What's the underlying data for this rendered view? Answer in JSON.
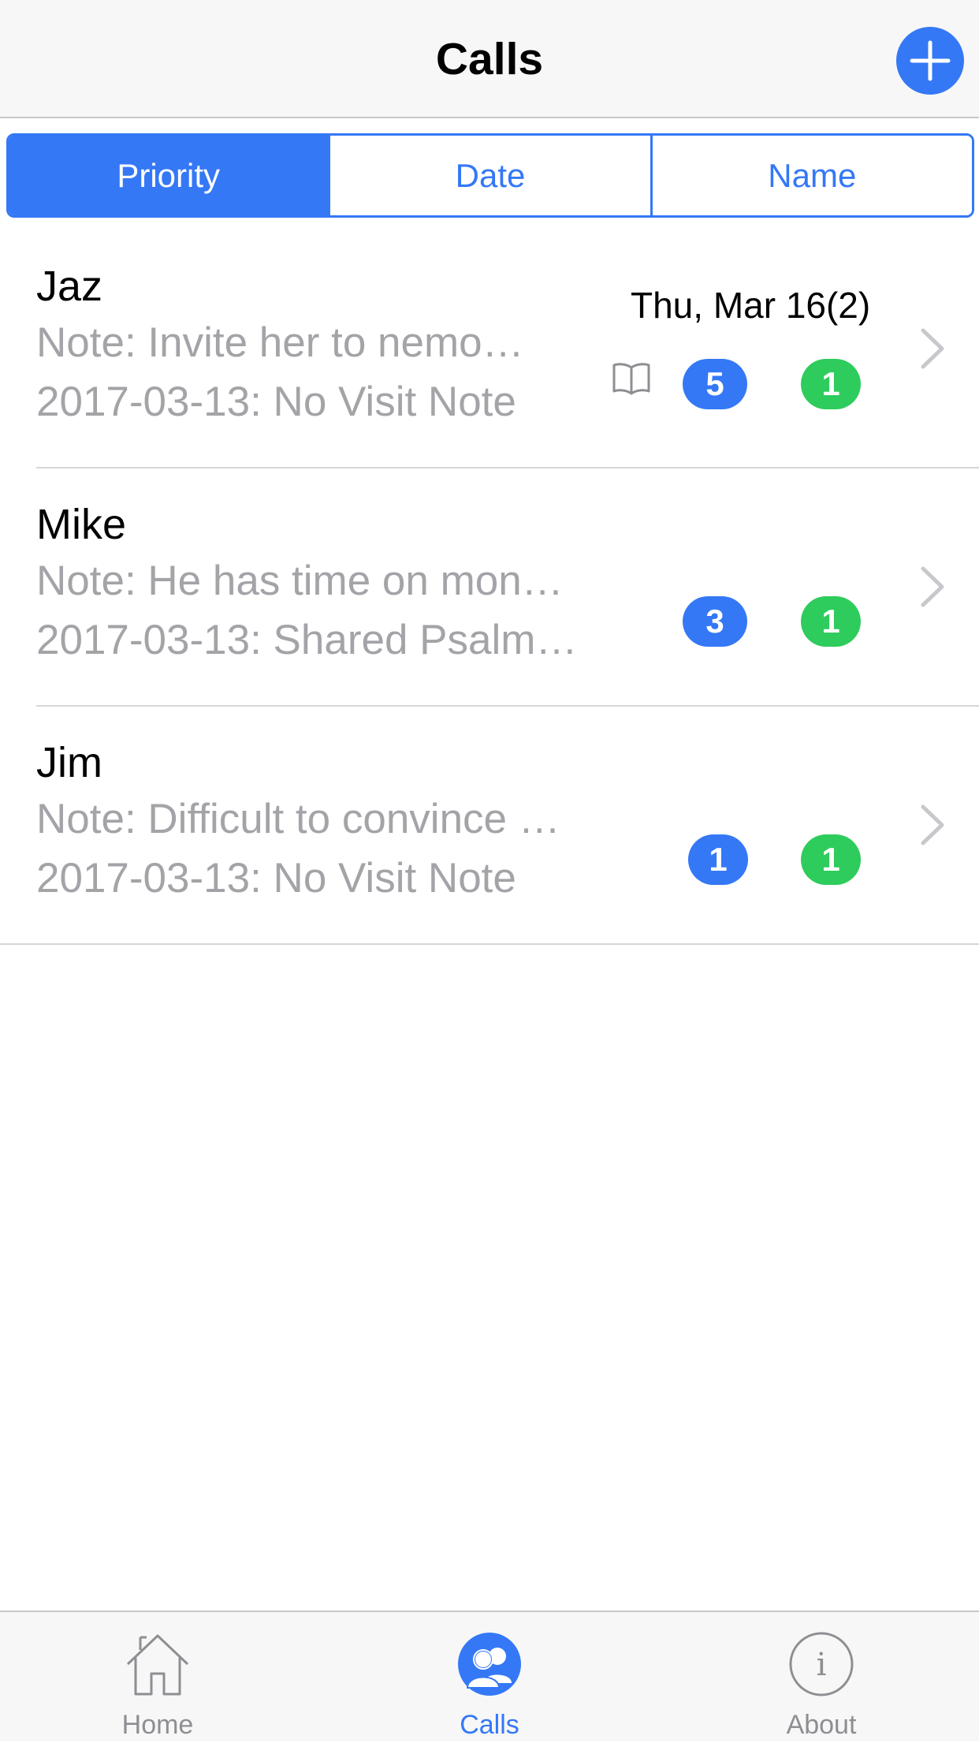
{
  "header": {
    "title": "Calls",
    "add_icon": "plus-icon"
  },
  "sort_tabs": [
    {
      "label": "Priority",
      "active": true
    },
    {
      "label": "Date",
      "active": false
    },
    {
      "label": "Name",
      "active": false
    }
  ],
  "calls": [
    {
      "name": "Jaz",
      "note": "Note: Invite her to nemo…",
      "visit": "2017-03-13: No Visit Note",
      "date": "Thu, Mar 16(2)",
      "book_icon": "book-icon",
      "blue_badge": "5",
      "green_badge": "1"
    },
    {
      "name": "Mike",
      "note": "Note: He has time on mon…",
      "visit": "2017-03-13: Shared Psalm…",
      "blue_badge": "3",
      "green_badge": "1"
    },
    {
      "name": "Jim",
      "note": "Note: Difficult to convince …",
      "visit": "2017-03-13: No Visit Note",
      "blue_badge": "1",
      "green_badge": "1"
    }
  ],
  "tab_bar": [
    {
      "label": "Home",
      "icon": "home-icon",
      "active": false
    },
    {
      "label": "Calls",
      "icon": "calls-icon",
      "active": true
    },
    {
      "label": "About",
      "icon": "info-icon",
      "active": false
    }
  ],
  "colors": {
    "accent": "#3478f6",
    "green_badge": "#2ecc5c",
    "subtext": "#a3a3a8"
  }
}
